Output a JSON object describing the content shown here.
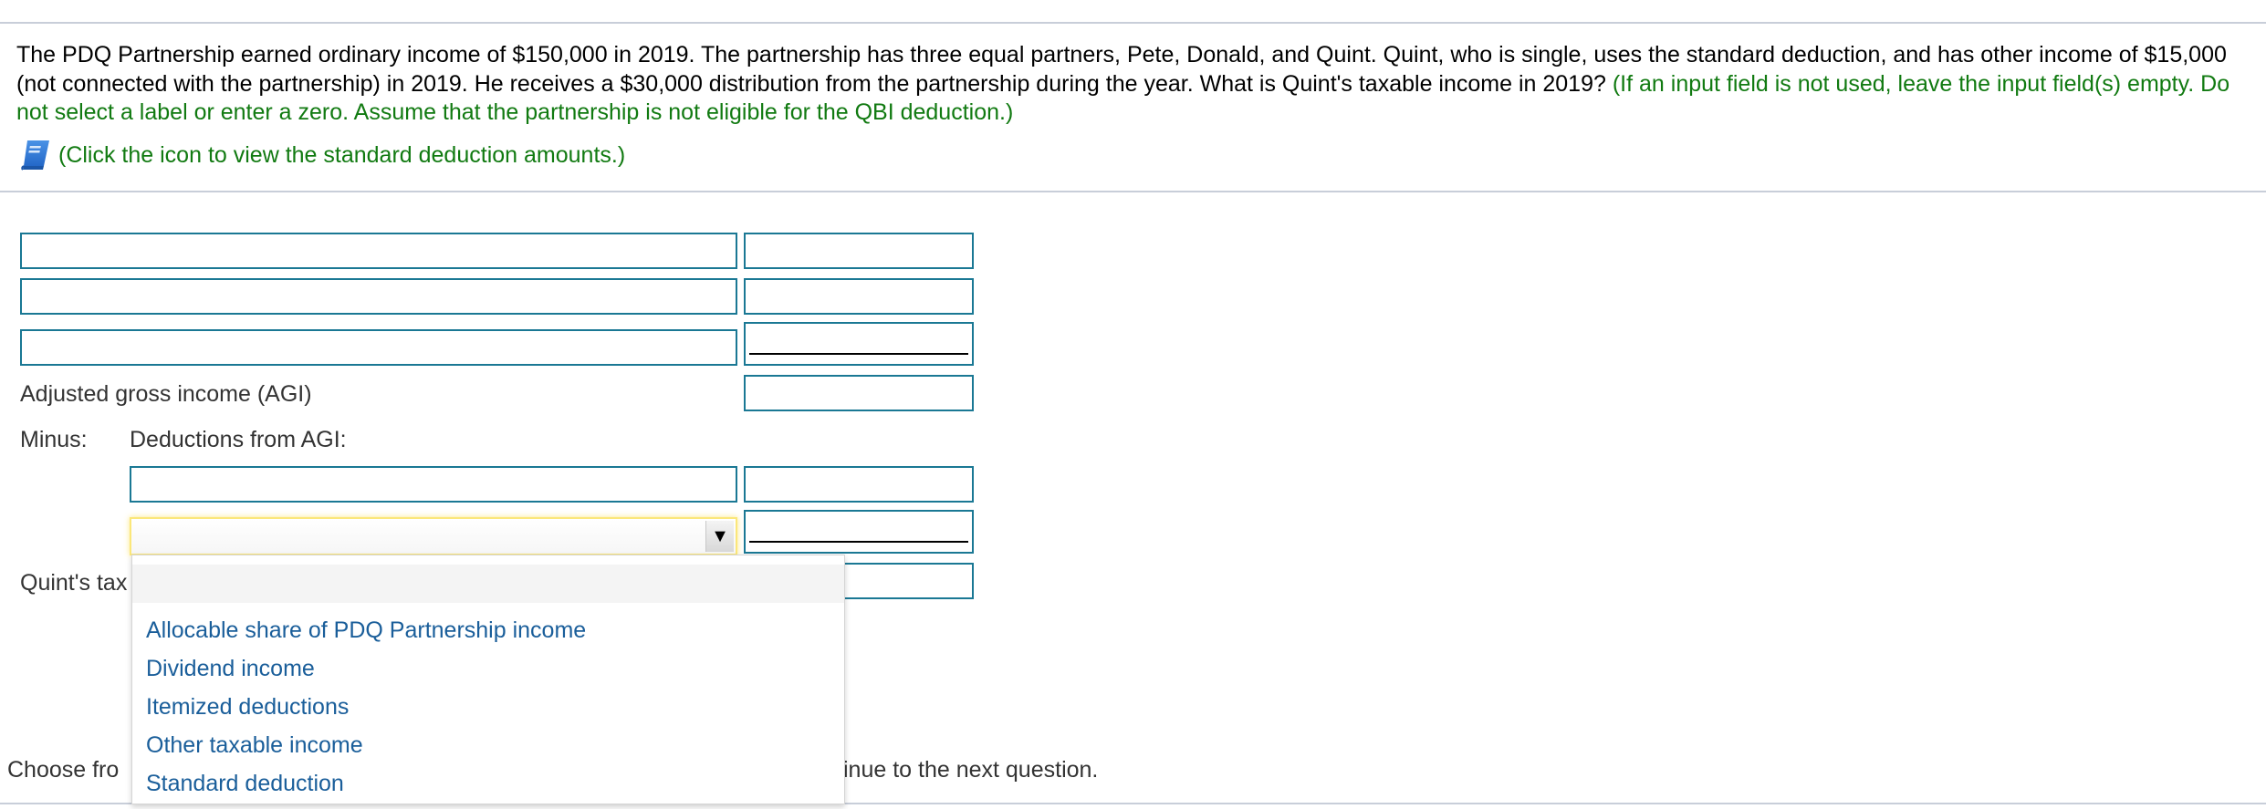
{
  "question": {
    "text": "The PDQ Partnership earned ordinary income of $150,000 in 2019. The partnership has three equal partners, Pete, Donald, and Quint. Quint, who is single, uses the standard deduction, and has other income of $15,000 (not connected with the partnership) in 2019. He receives a $30,000 distribution from the partnership during the year. What is Quint's taxable income in 2019?",
    "hint": "(If an input field is not used, leave the input field(s) empty. Do not select a label or enter a zero. Assume that the partnership is not eligible for the QBI deduction.)",
    "reference_icon": "book-icon",
    "reference_text": "(Click the icon to view the standard deduction amounts.)"
  },
  "form": {
    "income_rows": [
      {
        "label_value": "",
        "amount_value": ""
      },
      {
        "label_value": "",
        "amount_value": ""
      },
      {
        "label_value": "",
        "amount_value": ""
      }
    ],
    "agi_label": "Adjusted gross income (AGI)",
    "agi_value": "",
    "minus_label": "Minus:",
    "deductions_label": "Deductions from AGI:",
    "deduction_rows": [
      {
        "label_value": "",
        "amount_value": ""
      },
      {
        "label_value": "",
        "amount_value": ""
      }
    ],
    "taxable_label_visible": "Quint's tax",
    "taxable_value": ""
  },
  "dropdown": {
    "selected": "",
    "arrow_icon": "▼",
    "options": [
      "",
      "Allocable share of PDQ Partnership income",
      "Dividend income",
      "Itemized deductions",
      "Other taxable income",
      "Standard deduction"
    ]
  },
  "footer": {
    "instruction_left_visible": "Choose fro",
    "instruction_right_visible": "inue to the next question."
  },
  "colors": {
    "hint_green": "#117a11",
    "field_border": "#1a7894",
    "option_blue": "#1a5e9a",
    "focus_yellow": "#fbe77a",
    "divider": "#c8ced9"
  }
}
